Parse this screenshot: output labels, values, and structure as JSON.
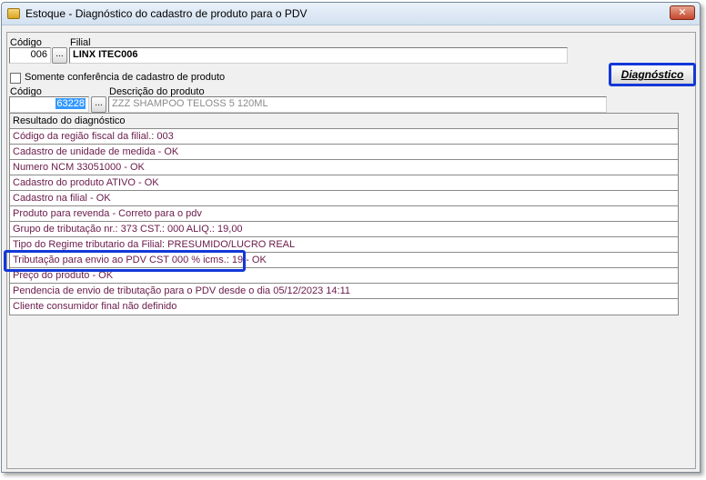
{
  "window": {
    "title": "Estoque - Diagnóstico do cadastro de produto para o PDV",
    "close_symbol": "✕"
  },
  "filter": {
    "codigo_label": "Código",
    "codigo_value": "006",
    "filial_label": "Filial",
    "filial_value": "LINX ITEC006",
    "lookup_label": "...",
    "checkbox_label": "Somente conferência de cadastro de produto",
    "checkbox_checked": false,
    "produto_codigo_label": "Código",
    "produto_codigo_value": "63228",
    "descricao_label": "Descrição do produto",
    "descricao_value": "ZZZ SHAMPOO TELOSS 5 120ML",
    "diagnostico_button": "Diagnóstico"
  },
  "results": {
    "header": "Resultado do diagnóstico",
    "rows": [
      "Código da região fiscal da filial.: 003",
      "Cadastro de unidade de medida - OK",
      "Numero NCM 33051000 - OK",
      "Cadastro do produto ATIVO - OK",
      "Cadastro na filial - OK",
      "Produto para revenda - Correto para o pdv",
      "Grupo de tributação nr.: 373 CST.: 000 ALIQ.: 19,00",
      "Tipo do Regime tributario da Filial: PRESUMIDO/LUCRO REAL",
      "Tributação para envio ao PDV CST 000 % icms.: 19 - OK",
      "Preço do produto - OK",
      "Pendencia de envio de tributação para o PDV desde o dia 05/12/2023 14:11",
      "Cliente consumidor final não definido"
    ]
  },
  "colors": {
    "highlight": "#1238d8",
    "row_text": "#6a1a4a",
    "selection": "#3399ff"
  }
}
